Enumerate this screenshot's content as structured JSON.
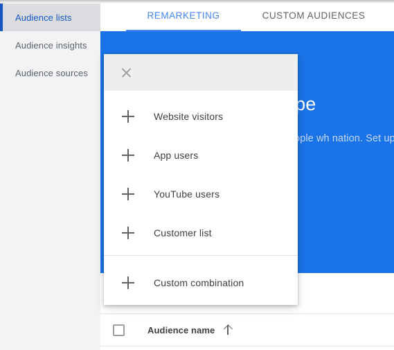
{
  "sidebar": {
    "items": [
      {
        "label": "Audience lists",
        "selected": true
      },
      {
        "label": "Audience insights",
        "selected": false
      },
      {
        "label": "Audience sources",
        "selected": false
      }
    ]
  },
  "tabs": [
    {
      "label": "REMARKETING",
      "active": true
    },
    {
      "label": "CUSTOM AUDIENCES",
      "active": false
    }
  ],
  "promo": {
    "title": "Reach pe",
    "body": "you reach people wh nation. Set up an audi"
  },
  "menu": {
    "close_icon": "close-icon",
    "items": [
      {
        "label": "Website visitors",
        "icon": "plus-icon"
      },
      {
        "label": "App users",
        "icon": "plus-icon"
      },
      {
        "label": "YouTube users",
        "icon": "plus-icon"
      },
      {
        "label": "Customer list",
        "icon": "plus-icon"
      },
      {
        "label": "Custom combination",
        "icon": "plus-icon"
      }
    ]
  },
  "table": {
    "column_header": "Audience name",
    "sort_direction": "ascending"
  },
  "colors": {
    "accent_blue": "#1a73e8",
    "tab_blue": "#4285f4",
    "sidebar_bg": "#f1f3f4",
    "sidebar_selected_bg": "#dadce0",
    "sidebar_selected_text": "#1a56c4",
    "menu_header_bg": "#eeeeee"
  }
}
